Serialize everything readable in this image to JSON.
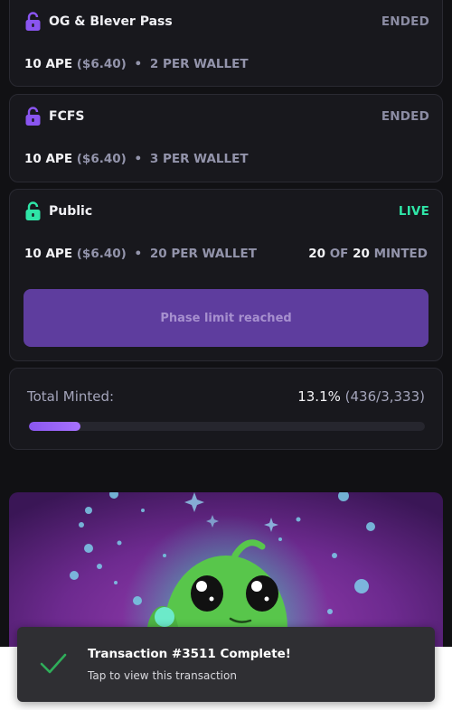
{
  "phases": [
    {
      "name": "OG & Blever Pass",
      "status": "ENDED",
      "price_ape": "10 APE",
      "price_usd": "($6.40)",
      "separator": "•",
      "limit": "2 PER WALLET",
      "lock_color": "#8a55f0"
    },
    {
      "name": "FCFS",
      "status": "ENDED",
      "price_ape": "10 APE",
      "price_usd": "($6.40)",
      "separator": "•",
      "limit": "3 PER WALLET",
      "lock_color": "#8a55f0"
    },
    {
      "name": "Public",
      "status": "LIVE",
      "price_ape": "10 APE",
      "price_usd": "($6.40)",
      "separator": "•",
      "limit": "20 PER WALLET",
      "lock_color": "#2fe5a7",
      "minted_count": "20",
      "minted_of": "OF",
      "minted_total": "20",
      "minted_label": "MINTED",
      "button_label": "Phase limit reached"
    }
  ],
  "total": {
    "label": "Total Minted:",
    "percent": "13.1%",
    "count": "(436/3,333)",
    "progress": 0.131
  },
  "toast": {
    "title": "Transaction #3511 Complete!",
    "subtitle": "Tap to view this transaction",
    "icon": "check-icon"
  },
  "colors": {
    "accent": "#8a56ef",
    "live": "#2fe5a7",
    "ended": "#8b8ca3",
    "button": "#5e3d9e"
  }
}
